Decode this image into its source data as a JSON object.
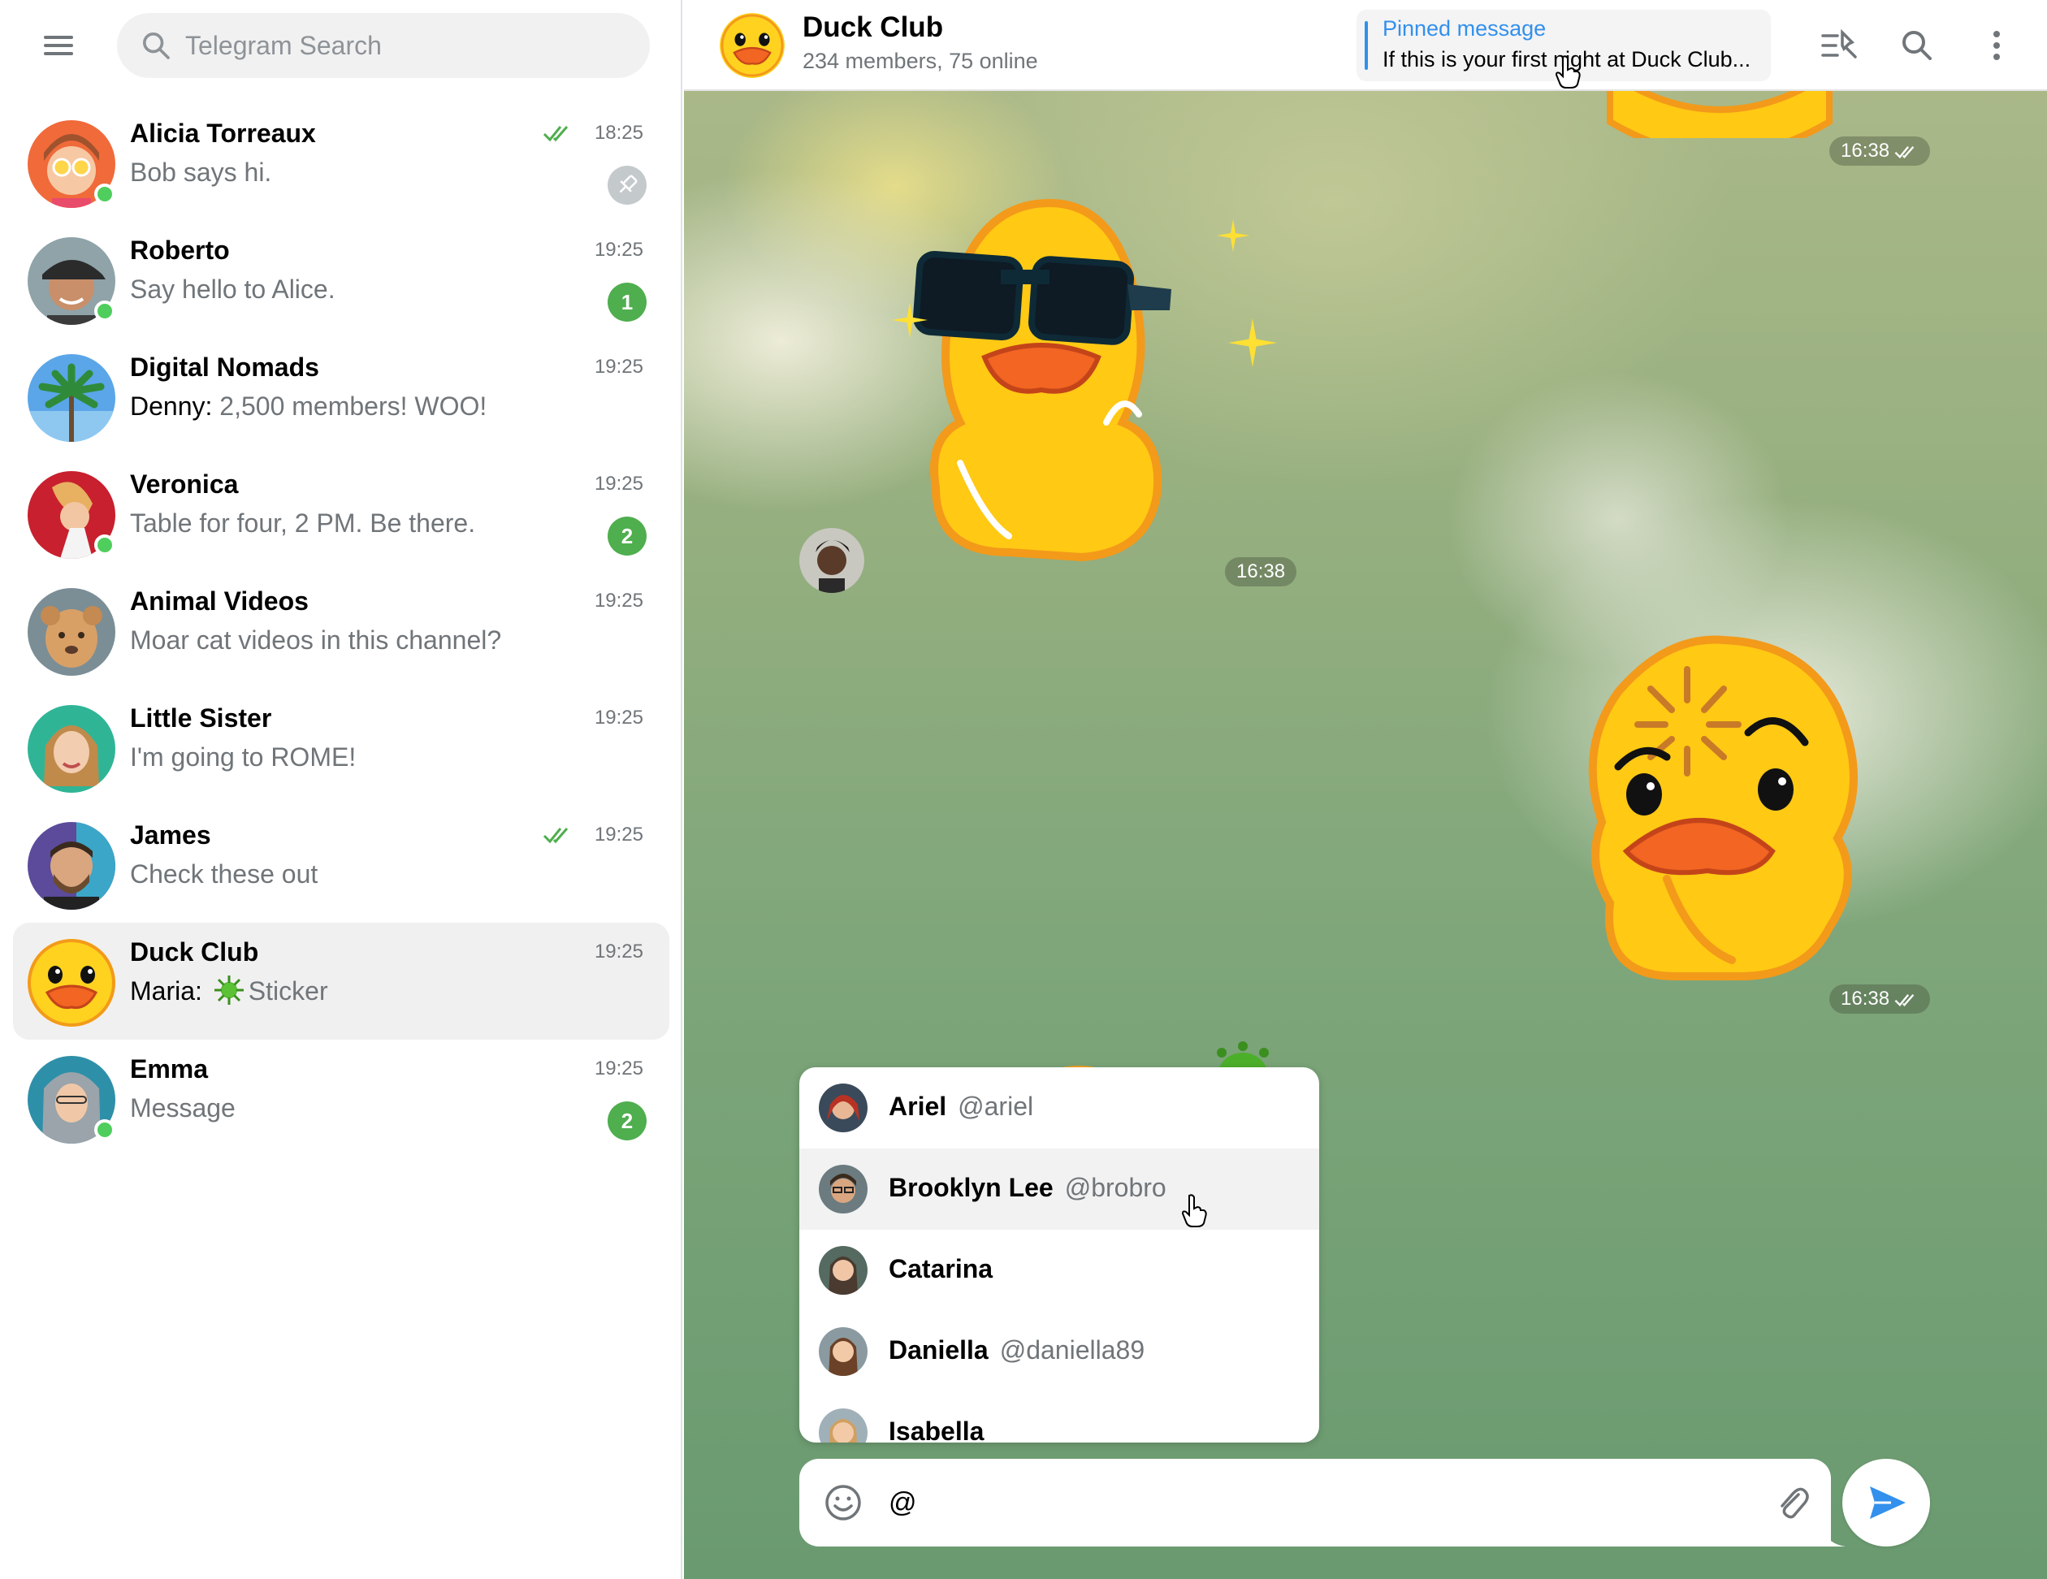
{
  "search": {
    "placeholder": "Telegram Search"
  },
  "chats": [
    {
      "name": "Alicia Torreaux",
      "preview": "Bob says hi.",
      "time": "18:25",
      "read": true,
      "pinned": true,
      "online": true
    },
    {
      "name": "Roberto",
      "preview": "Say hello to Alice.",
      "time": "19:25",
      "unread": "1",
      "online": true
    },
    {
      "name": "Digital Nomads",
      "sender": "Denny:",
      "preview": "2,500 members! WOO!",
      "time": "19:25"
    },
    {
      "name": "Veronica",
      "preview": "Table for four, 2 PM. Be there.",
      "time": "19:25",
      "unread": "2",
      "online": true
    },
    {
      "name": "Animal Videos",
      "preview": "Moar cat videos in this channel?",
      "time": "19:25"
    },
    {
      "name": "Little Sister",
      "preview": "I'm going to ROME!",
      "time": "19:25"
    },
    {
      "name": "James",
      "preview": "Check these out",
      "time": "19:25",
      "read": true
    },
    {
      "name": "Duck Club",
      "sender": "Maria:",
      "preview": "Sticker",
      "time": "19:25",
      "active": true
    },
    {
      "name": "Emma",
      "preview": "Message",
      "time": "19:25",
      "unread": "2",
      "online": true
    }
  ],
  "header": {
    "title": "Duck Club",
    "subtitle": "234 members, 75 online",
    "pinned_label": "Pinned message",
    "pinned_text": "If this is your first night at Duck Club..."
  },
  "messages": [
    {
      "time": "16:38",
      "outgoing": true,
      "read": true
    },
    {
      "time": "16:38",
      "outgoing": false
    },
    {
      "time": "16:38",
      "outgoing": true,
      "read": true
    }
  ],
  "mentions": [
    {
      "name": "Ariel",
      "handle": "@ariel"
    },
    {
      "name": "Brooklyn Lee",
      "handle": "@brobro"
    },
    {
      "name": "Catarina",
      "handle": ""
    },
    {
      "name": "Daniella",
      "handle": "@daniella89"
    },
    {
      "name": "Isabella",
      "handle": ""
    }
  ],
  "composer": {
    "value": "@"
  },
  "colors": {
    "accent": "#3390ec",
    "online": "#4fce5d",
    "badge": "#4fae4e",
    "muted": "#707579"
  },
  "icons": [
    "menu-icon",
    "search-icon",
    "pin-icon",
    "check-icon",
    "pinned-messages-icon",
    "more-icon",
    "emoji-icon",
    "attach-icon",
    "send-icon"
  ]
}
